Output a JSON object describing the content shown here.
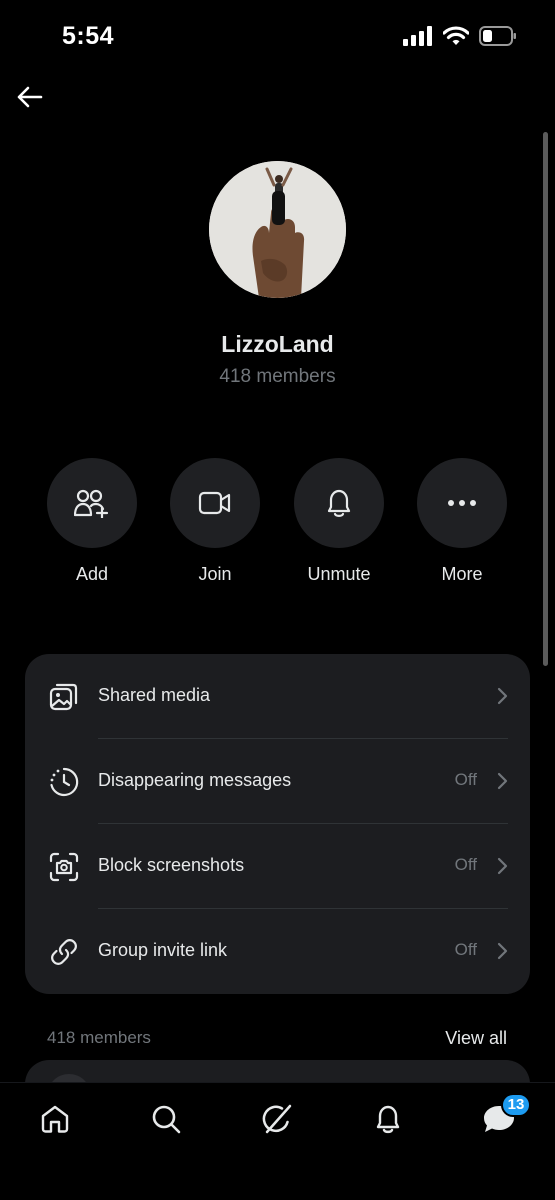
{
  "status_bar": {
    "time": "5:54",
    "icons": [
      "cellular-signal-icon",
      "wifi-icon",
      "battery-icon"
    ]
  },
  "header": {
    "back_icon": "back-arrow-icon"
  },
  "group": {
    "name": "LizzoLand",
    "member_count_text": "418 members"
  },
  "actions": [
    {
      "label": "Add",
      "icon": "add-people-icon"
    },
    {
      "label": "Join",
      "icon": "video-camera-icon"
    },
    {
      "label": "Unmute",
      "icon": "bell-icon"
    },
    {
      "label": "More",
      "icon": "more-dots-icon"
    }
  ],
  "settings": [
    {
      "label": "Shared media",
      "value": "",
      "icon": "image-stack-icon"
    },
    {
      "label": "Disappearing messages",
      "value": "Off",
      "icon": "timer-icon"
    },
    {
      "label": "Block screenshots",
      "value": "Off",
      "icon": "camera-frame-icon"
    },
    {
      "label": "Group invite link",
      "value": "Off",
      "icon": "link-icon"
    }
  ],
  "members_section": {
    "header": "418 members",
    "view_all_label": "View all"
  },
  "bottom_nav": {
    "items": [
      "home-icon",
      "search-icon",
      "grok-icon",
      "notifications-icon",
      "messages-icon"
    ],
    "messages_badge": "13"
  },
  "colors": {
    "background": "#000000",
    "card": "#1c1d20",
    "action_circle": "#1f2023",
    "primary_text": "#e7e9ea",
    "secondary_text": "#71767b",
    "badge": "#1d9bf0"
  }
}
